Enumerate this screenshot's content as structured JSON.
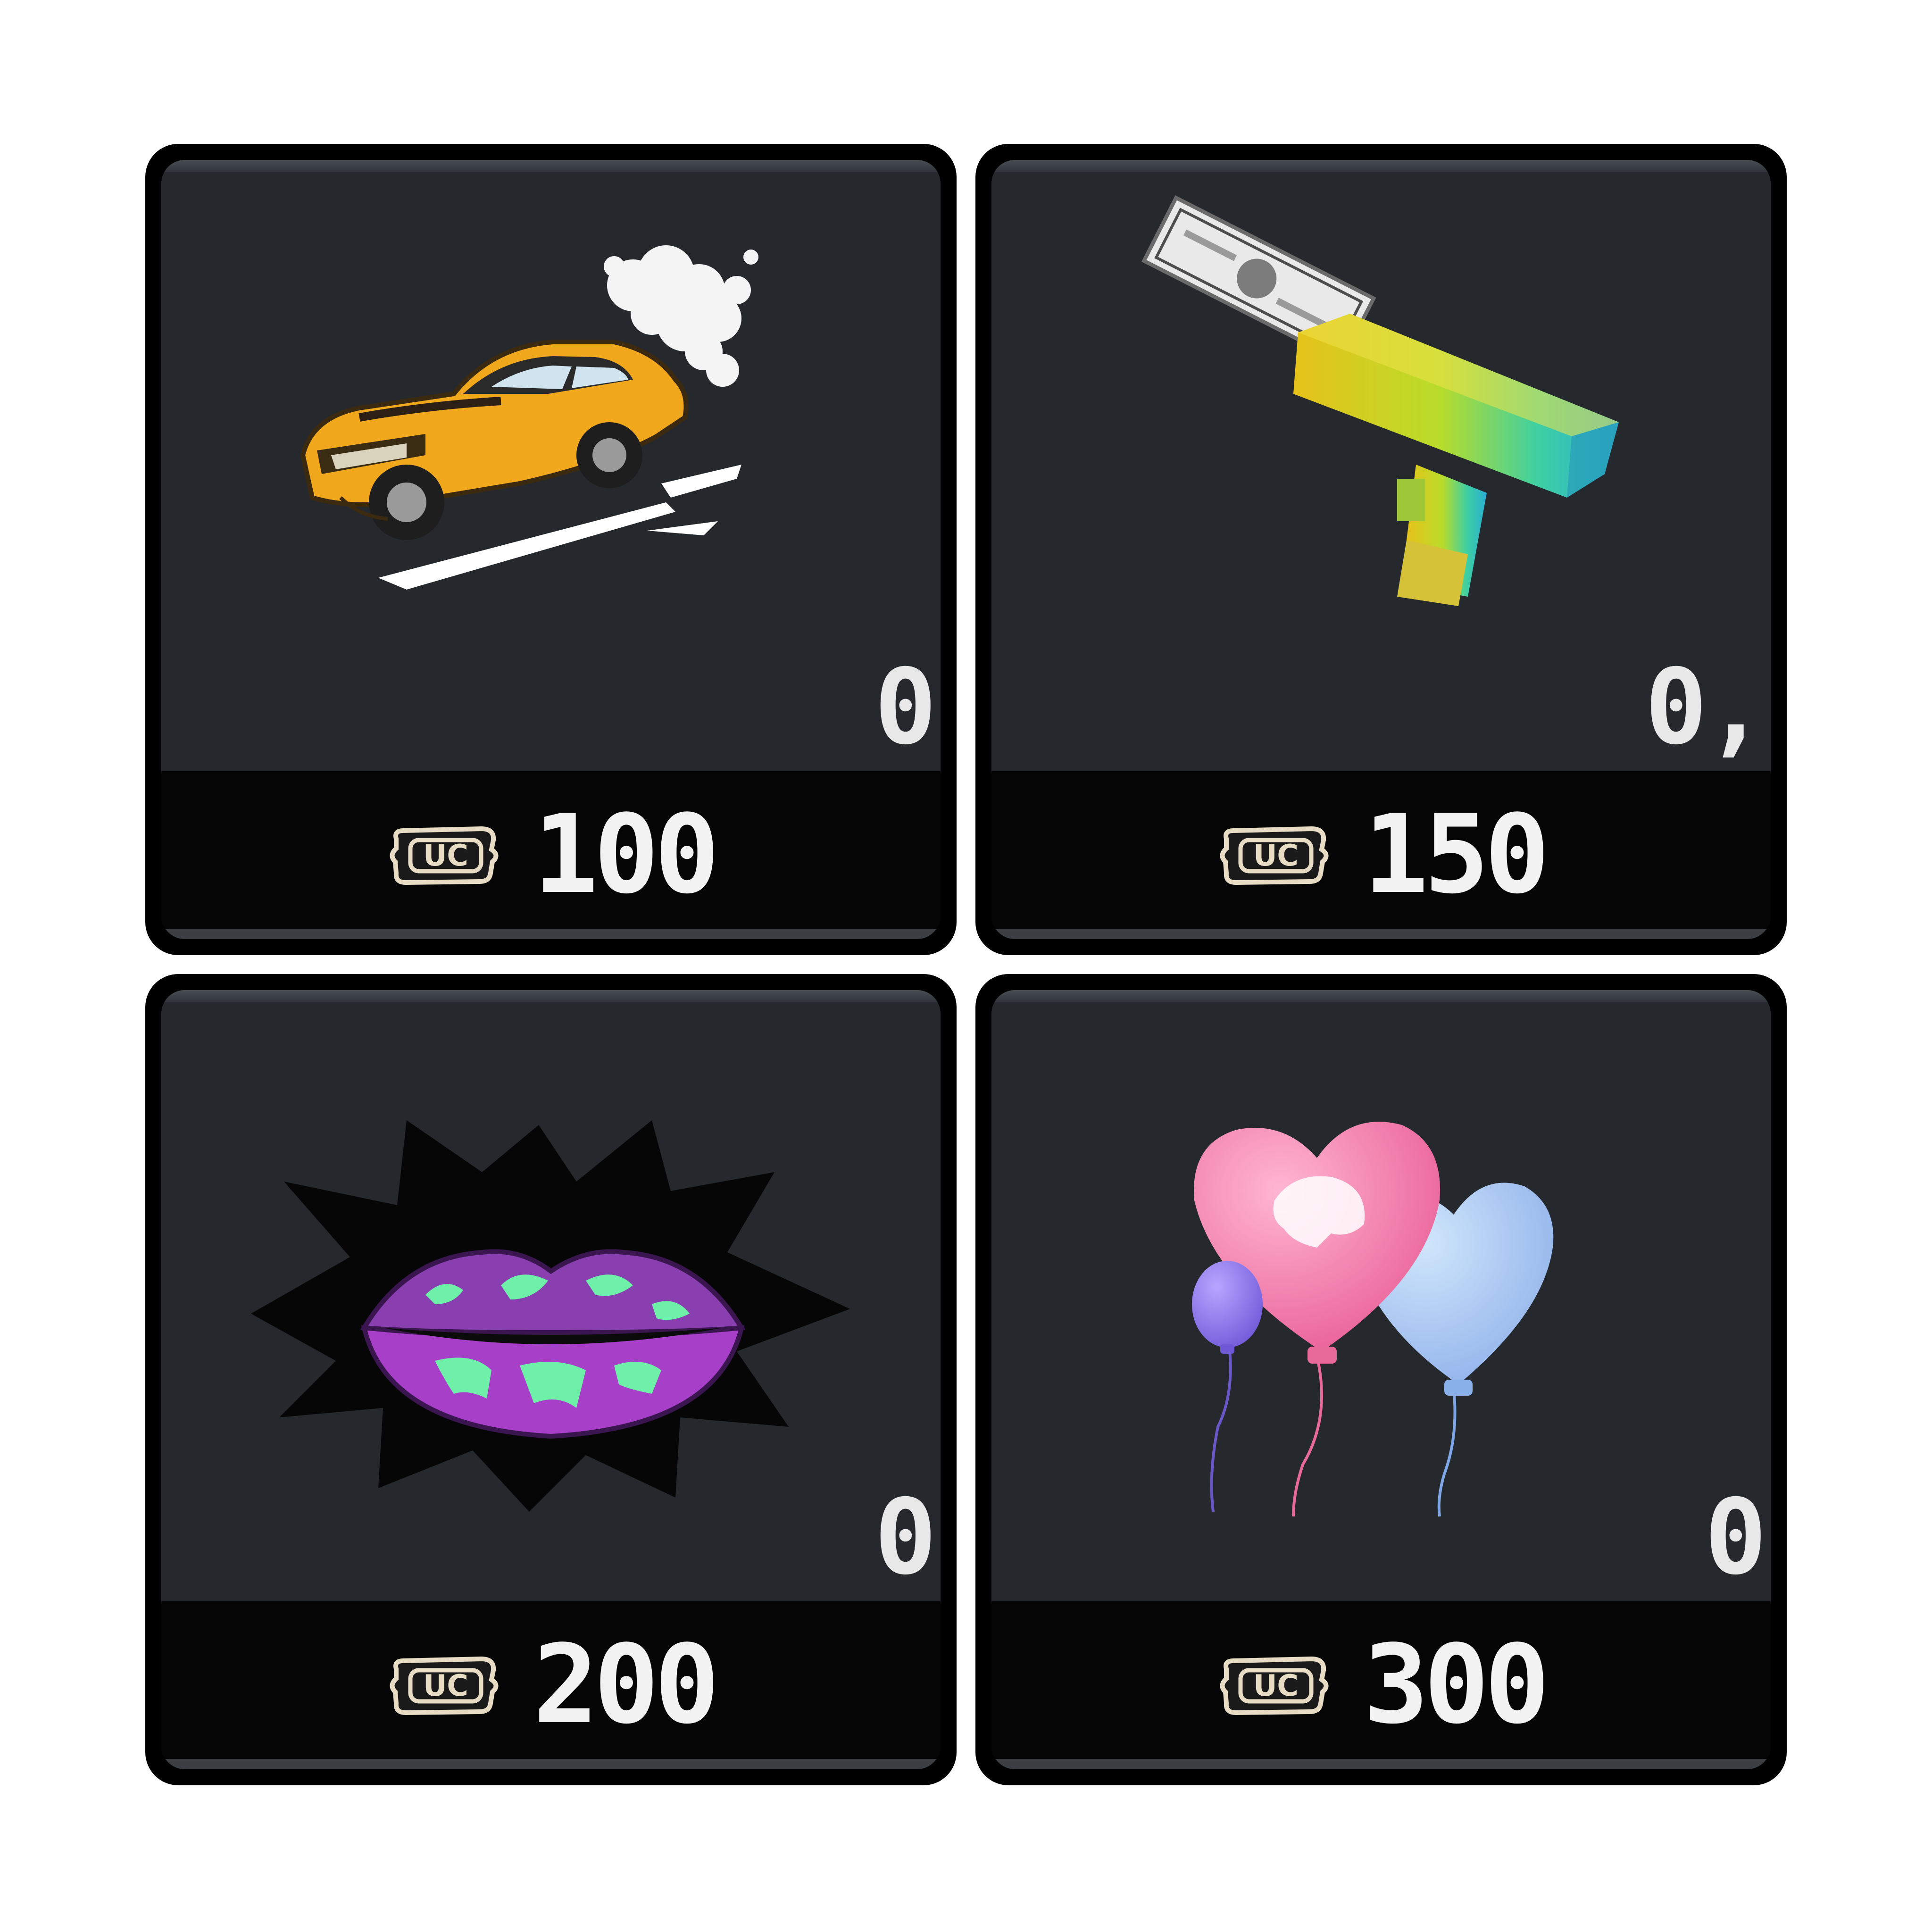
{
  "colors": {
    "card_frame": "#000000",
    "card_background": "#25282c",
    "price_bar": "#050505",
    "price_text": "#f2f2f2",
    "uc_icon": "#e8dcc4"
  },
  "currency_icon": "uc-coin-icon",
  "currency_icon_text": "UC",
  "items": [
    {
      "icon": "yellow-car-graffiti-icon",
      "count": "0",
      "price": "100"
    },
    {
      "icon": "money-gun-icon",
      "count": "0,",
      "price": "150"
    },
    {
      "icon": "purple-lips-icon",
      "count": "0",
      "price": "200"
    },
    {
      "icon": "heart-balloons-icon",
      "count": "0",
      "price": "300"
    }
  ]
}
